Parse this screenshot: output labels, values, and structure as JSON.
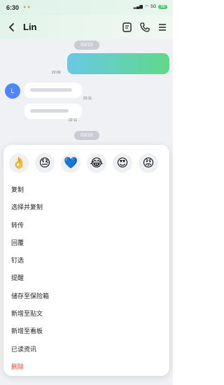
{
  "status": {
    "time": "6:30",
    "indicators": "5G",
    "battery": "98"
  },
  "header": {
    "title": "Lin"
  },
  "chat": {
    "date1": "03/15",
    "time_out": "22:09",
    "avatar_letter": "L",
    "time_in1": "22:11",
    "time_in2": "22:11",
    "date2": "03/16"
  },
  "emojis": [
    "👌",
    "😓",
    "💙",
    "😂",
    "😍",
    "😡"
  ],
  "menu": [
    "复制",
    "选择并复制",
    "转传",
    "回覆",
    "钉选",
    "提醒",
    "储存至保险箱",
    "新增至贴文",
    "新增至看板",
    "已读资讯",
    "删除"
  ],
  "colors": {
    "accent_gradient_start": "#69c8e4",
    "accent_gradient_end": "#5fd98a",
    "danger": "#e0453a",
    "avatar": "#4f86f5"
  }
}
